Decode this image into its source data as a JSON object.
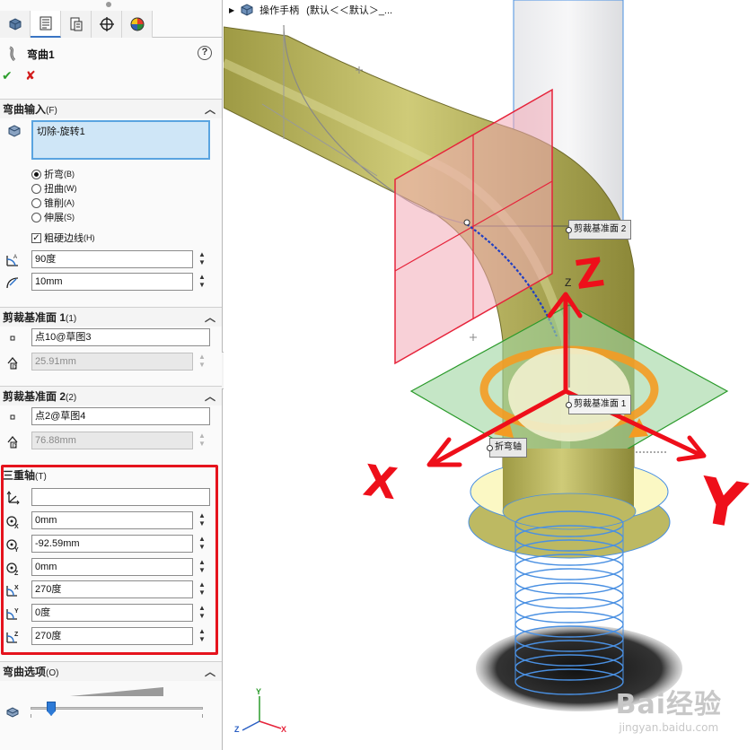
{
  "tabs": [
    {
      "icon": "feature-manager-icon"
    },
    {
      "icon": "property-manager-icon",
      "active": true
    },
    {
      "icon": "configuration-manager-icon"
    },
    {
      "icon": "dimxpert-icon"
    },
    {
      "icon": "display-manager-icon"
    }
  ],
  "feature": {
    "title": "弯曲1",
    "help": "?",
    "ok": "✔",
    "cancel": "✘"
  },
  "flex_input": {
    "header": "弯曲输入",
    "header_key": "(F)",
    "bodies": "切除-旋转1",
    "options": [
      {
        "label": "折弯",
        "key": "(B)",
        "selected": true
      },
      {
        "label": "扭曲",
        "key": "(W)",
        "selected": false
      },
      {
        "label": "锥削",
        "key": "(A)",
        "selected": false
      },
      {
        "label": "伸展",
        "key": "(S)",
        "selected": false
      }
    ],
    "hard_edges_label": "粗硬边线",
    "hard_edges_key": "(H)",
    "hard_edges_checked": true,
    "angle": "90度",
    "radius": "10mm"
  },
  "trim_plane_1": {
    "header": "剪裁基准面 1",
    "header_key": "(1)",
    "entity": "点10@草图3",
    "distance": "25.91mm"
  },
  "trim_plane_2": {
    "header": "剪裁基准面 2",
    "header_key": "(2)",
    "entity": "点2@草图4",
    "distance": "76.88mm"
  },
  "triad": {
    "header": "三重轴",
    "header_key": "(T)",
    "selection": "",
    "x_pos": "0mm",
    "y_pos": "-92.59mm",
    "z_pos": "0mm",
    "x_rot": "270度",
    "y_rot": "0度",
    "z_rot": "270度"
  },
  "flex_options": {
    "header": "弯曲选项",
    "header_key": "(O)",
    "accuracy_fraction": 0.12
  },
  "viewport": {
    "breadcrumb_part": "操作手柄",
    "breadcrumb_config": "(默认＜＜默认＞_...",
    "callout_trim2": "剪裁基准面 2",
    "callout_trim1": "剪裁基准面 1",
    "callout_bend_axis": "折弯轴",
    "triad_z_label": "Z",
    "axis_labels": {
      "x": "X",
      "y": "Y",
      "z": "Z"
    },
    "annotations": {
      "x": "X",
      "y": "Y",
      "z": "Z"
    },
    "watermark_brand": "Bai经验",
    "watermark_url": "jingyan.baidu.com"
  },
  "colors": {
    "part_yellow": "#bdb962",
    "plane_red": "#e6233a",
    "plane_green": "#2a9a2a",
    "annotation_red": "#ee0f1a",
    "selection_blue": "#4a90e2"
  }
}
